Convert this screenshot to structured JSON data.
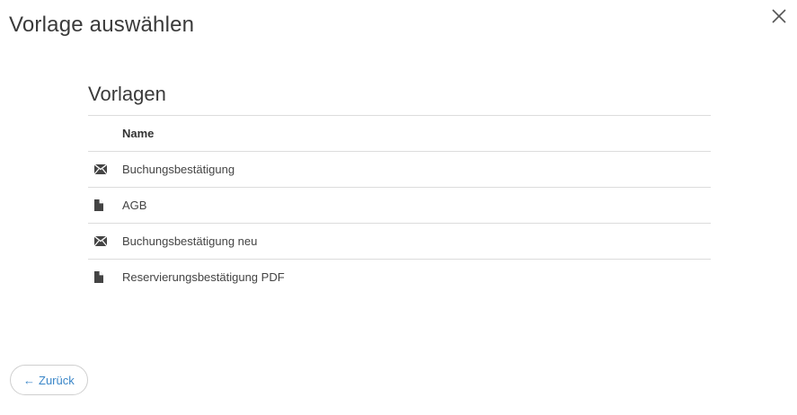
{
  "dialog": {
    "title": "Vorlage auswählen",
    "close_icon": "close-icon"
  },
  "section": {
    "title": "Vorlagen",
    "table": {
      "columns": [
        "",
        "Name"
      ],
      "rows": [
        {
          "icon": "envelope-icon",
          "name": "Buchungsbestätigung"
        },
        {
          "icon": "file-icon",
          "name": "AGB"
        },
        {
          "icon": "envelope-icon",
          "name": "Buchungsbestätigung neu"
        },
        {
          "icon": "file-icon",
          "name": "Reservierungsbestätigung PDF"
        }
      ]
    }
  },
  "footer": {
    "back_arrow": "←",
    "back_label": "Zurück"
  },
  "colors": {
    "link": "#3a86c8",
    "border": "#dcdcdc",
    "text": "#444444"
  }
}
